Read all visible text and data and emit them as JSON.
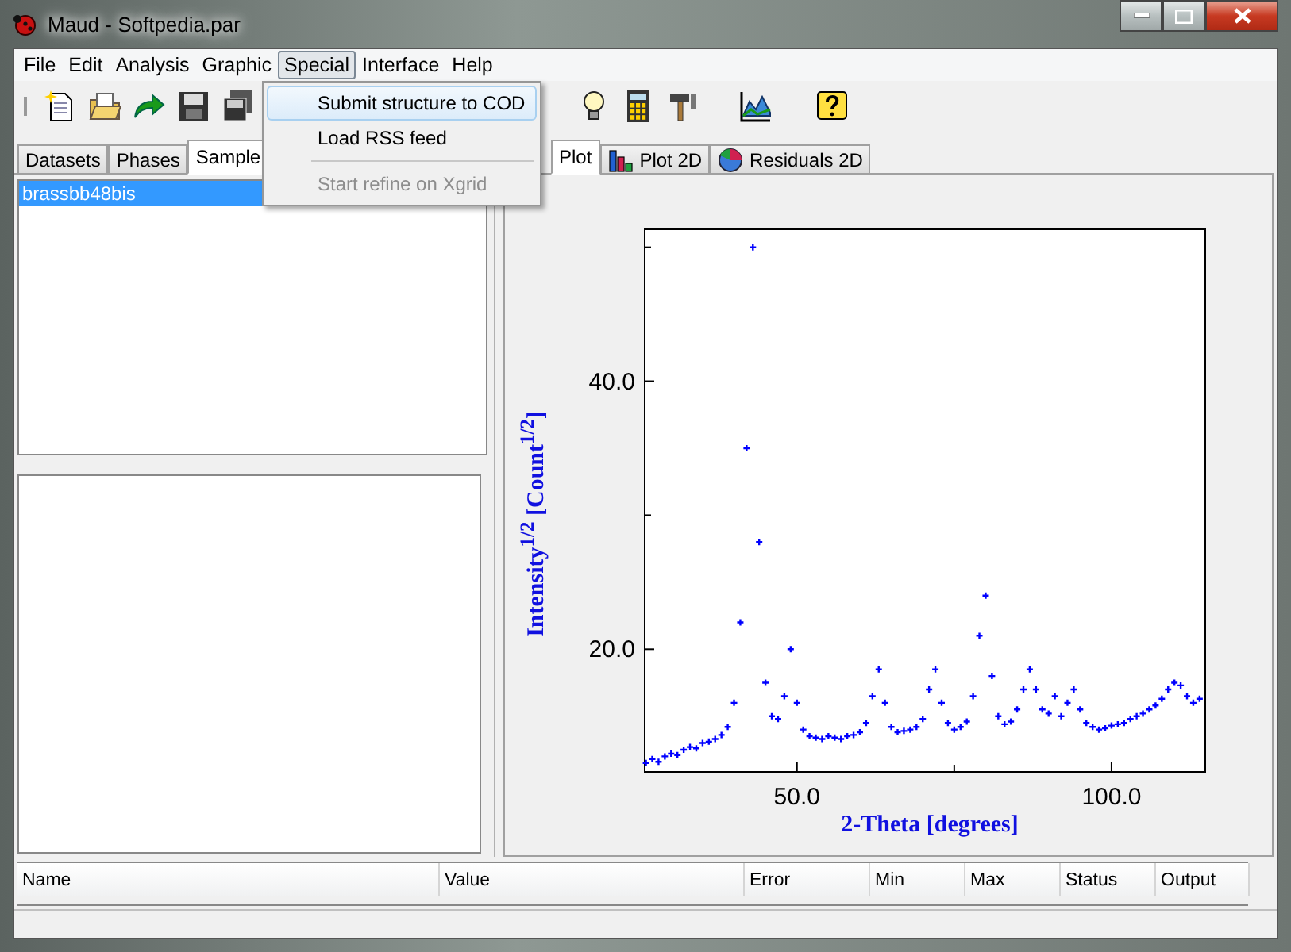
{
  "window": {
    "title": "Maud - Softpedia.par"
  },
  "menu_bar": [
    {
      "label": "File",
      "selected": false
    },
    {
      "label": "Edit",
      "selected": false
    },
    {
      "label": "Analysis",
      "selected": false
    },
    {
      "label": "Graphic",
      "selected": false
    },
    {
      "label": "Special",
      "selected": true
    },
    {
      "label": "Interface",
      "selected": false
    },
    {
      "label": "Help",
      "selected": false
    }
  ],
  "open_menu": {
    "items": [
      {
        "kind": "item",
        "label": "Submit structure to COD",
        "highlighted": true,
        "disabled": false
      },
      {
        "kind": "item",
        "label": "Load RSS feed",
        "highlighted": false,
        "disabled": false
      },
      {
        "kind": "separator"
      },
      {
        "kind": "item",
        "label": "Start refine on Xgrid",
        "highlighted": false,
        "disabled": true
      }
    ]
  },
  "left_tabs": [
    {
      "label": "Datasets",
      "selected": false
    },
    {
      "label": "Phases",
      "selected": false
    },
    {
      "label": "Sample",
      "selected": true
    }
  ],
  "sample_list": [
    {
      "label": "brassbb48bis",
      "selected": true
    }
  ],
  "plot_tabs": [
    {
      "label": "Plot",
      "selected": true,
      "kind": "plain"
    },
    {
      "label": "Plot 2D",
      "selected": false,
      "kind": "bars"
    },
    {
      "label": "Residuals 2D",
      "selected": false,
      "kind": "pie"
    }
  ],
  "chart_data": {
    "type": "scatter",
    "xlabel": "2-Theta [degrees]",
    "ylabel": "Intensity$^{1/2}$ [Count$^{1/2}$]",
    "xlim": [
      25.8,
      114.9
    ],
    "ylim": [
      10.9,
      51.4
    ],
    "xticks": [
      {
        "value": 50,
        "label": "50.0"
      },
      {
        "value": 100,
        "label": "100.0"
      }
    ],
    "yticks": [
      {
        "value": 20,
        "label": "20.0"
      },
      {
        "value": 40,
        "label": "40.0"
      }
    ],
    "x": [
      26,
      27,
      28,
      29,
      30,
      31,
      32,
      33,
      34,
      35,
      36,
      37,
      38,
      39,
      40,
      41,
      42,
      43,
      44,
      45,
      46,
      47,
      48,
      49,
      50,
      51,
      52,
      53,
      54,
      55,
      56,
      57,
      58,
      59,
      60,
      61,
      62,
      63,
      64,
      65,
      66,
      67,
      68,
      69,
      70,
      71,
      72,
      73,
      74,
      75,
      76,
      77,
      78,
      79,
      80,
      81,
      82,
      83,
      84,
      85,
      86,
      87,
      88,
      89,
      90,
      91,
      92,
      93,
      94,
      95,
      96,
      97,
      98,
      99,
      100,
      101,
      102,
      103,
      104,
      105,
      106,
      107,
      108,
      109,
      110,
      111,
      112,
      113,
      114
    ],
    "series": [
      {
        "color": "#0000ff",
        "values": [
          11.5,
          11.8,
          11.6,
          12.0,
          12.2,
          12.1,
          12.5,
          12.7,
          12.6,
          13.0,
          13.1,
          13.3,
          13.6,
          14.2,
          16.0,
          22.0,
          35.0,
          50.0,
          28.0,
          17.5,
          15.0,
          14.8,
          16.5,
          20.0,
          16.0,
          14.0,
          13.5,
          13.4,
          13.3,
          13.5,
          13.4,
          13.3,
          13.5,
          13.6,
          13.8,
          14.5,
          16.5,
          18.5,
          16.0,
          14.2,
          13.8,
          13.9,
          14.0,
          14.2,
          14.8,
          17.0,
          18.5,
          16.0,
          14.5,
          14.0,
          14.2,
          14.6,
          16.5,
          21.0,
          24.0,
          18.0,
          15.0,
          14.4,
          14.6,
          15.5,
          17.0,
          18.5,
          17.0,
          15.5,
          15.2,
          16.5,
          15.0,
          16.0,
          17.0,
          15.5,
          14.5,
          14.2,
          14.0,
          14.1,
          14.3,
          14.4,
          14.5,
          14.8,
          15.0,
          15.2,
          15.5,
          15.8,
          16.3,
          17.0,
          17.5,
          17.3,
          16.5,
          16.0,
          16.3
        ]
      }
    ]
  },
  "parameter_table": {
    "columns": [
      "Name",
      "Value",
      "Error",
      "Min",
      "Max",
      "Status",
      "Output"
    ]
  }
}
